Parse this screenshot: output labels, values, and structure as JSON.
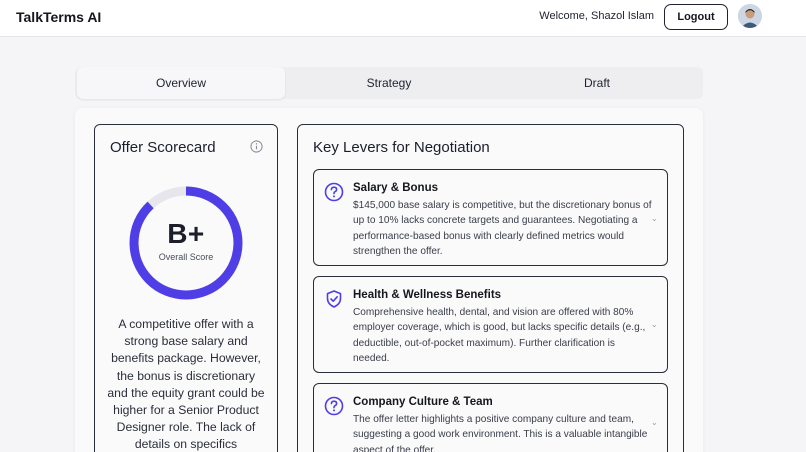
{
  "header": {
    "brand": "TalkTerms AI",
    "welcome": "Welcome, Shazol Islam",
    "logout_label": "Logout"
  },
  "tabs": [
    {
      "label": "Overview",
      "active": true
    },
    {
      "label": "Strategy",
      "active": false
    },
    {
      "label": "Draft",
      "active": false
    }
  ],
  "scorecard": {
    "title": "Offer Scorecard",
    "grade": "B+",
    "grade_caption": "Overall Score",
    "score_fraction": 0.88,
    "summary": "A competitive offer with a strong base salary and benefits package. However, the bonus is discretionary and the equity grant could be higher for a Senior Product Designer role. The lack of details on specifics"
  },
  "levers": {
    "title": "Key Levers for Negotiation",
    "items": [
      {
        "icon": "question-circle-icon",
        "title": "Salary & Bonus",
        "body": "$145,000 base salary is competitive, but the discretionary bonus of up to 10% lacks concrete targets and guarantees. Negotiating a performance-based bonus with clearly defined metrics would strengthen the offer."
      },
      {
        "icon": "shield-check-icon",
        "title": "Health & Wellness Benefits",
        "body": "Comprehensive health, dental, and vision are offered with 80% employer coverage, which is good, but lacks specific details (e.g., deductible, out-of-pocket maximum). Further clarification is needed."
      },
      {
        "icon": "question-circle-icon",
        "title": "Company Culture & Team",
        "body": "The offer letter highlights a positive company culture and team, suggesting a good work environment. This is a valuable intangible aspect of the offer."
      }
    ]
  },
  "colors": {
    "accent": "#4f3ee6",
    "track": "#e6e6ec",
    "border": "#2a2d3a"
  }
}
